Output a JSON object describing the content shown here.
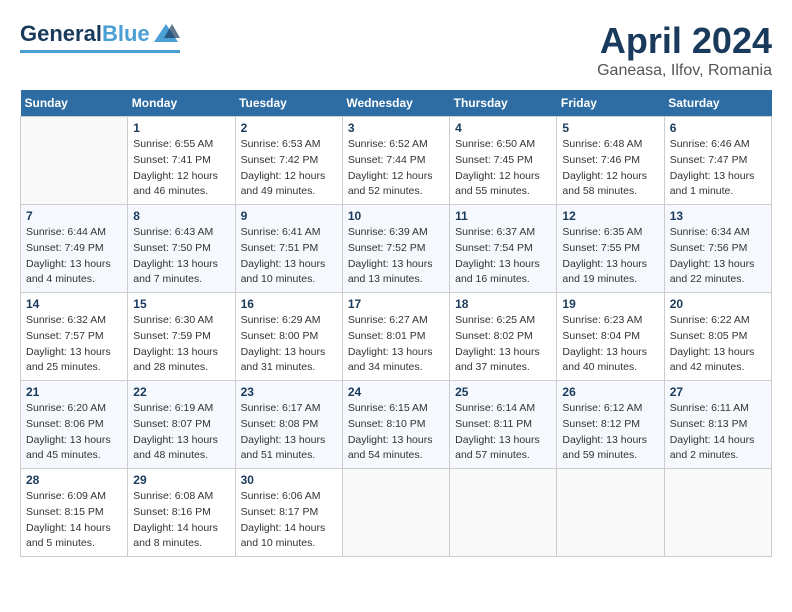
{
  "header": {
    "logo_general": "General",
    "logo_blue": "Blue",
    "title": "April 2024",
    "location": "Ganeasa, Ilfov, Romania"
  },
  "calendar": {
    "days_of_week": [
      "Sunday",
      "Monday",
      "Tuesday",
      "Wednesday",
      "Thursday",
      "Friday",
      "Saturday"
    ],
    "weeks": [
      [
        {
          "day": "",
          "info": ""
        },
        {
          "day": "1",
          "info": "Sunrise: 6:55 AM\nSunset: 7:41 PM\nDaylight: 12 hours\nand 46 minutes."
        },
        {
          "day": "2",
          "info": "Sunrise: 6:53 AM\nSunset: 7:42 PM\nDaylight: 12 hours\nand 49 minutes."
        },
        {
          "day": "3",
          "info": "Sunrise: 6:52 AM\nSunset: 7:44 PM\nDaylight: 12 hours\nand 52 minutes."
        },
        {
          "day": "4",
          "info": "Sunrise: 6:50 AM\nSunset: 7:45 PM\nDaylight: 12 hours\nand 55 minutes."
        },
        {
          "day": "5",
          "info": "Sunrise: 6:48 AM\nSunset: 7:46 PM\nDaylight: 12 hours\nand 58 minutes."
        },
        {
          "day": "6",
          "info": "Sunrise: 6:46 AM\nSunset: 7:47 PM\nDaylight: 13 hours\nand 1 minute."
        }
      ],
      [
        {
          "day": "7",
          "info": "Sunrise: 6:44 AM\nSunset: 7:49 PM\nDaylight: 13 hours\nand 4 minutes."
        },
        {
          "day": "8",
          "info": "Sunrise: 6:43 AM\nSunset: 7:50 PM\nDaylight: 13 hours\nand 7 minutes."
        },
        {
          "day": "9",
          "info": "Sunrise: 6:41 AM\nSunset: 7:51 PM\nDaylight: 13 hours\nand 10 minutes."
        },
        {
          "day": "10",
          "info": "Sunrise: 6:39 AM\nSunset: 7:52 PM\nDaylight: 13 hours\nand 13 minutes."
        },
        {
          "day": "11",
          "info": "Sunrise: 6:37 AM\nSunset: 7:54 PM\nDaylight: 13 hours\nand 16 minutes."
        },
        {
          "day": "12",
          "info": "Sunrise: 6:35 AM\nSunset: 7:55 PM\nDaylight: 13 hours\nand 19 minutes."
        },
        {
          "day": "13",
          "info": "Sunrise: 6:34 AM\nSunset: 7:56 PM\nDaylight: 13 hours\nand 22 minutes."
        }
      ],
      [
        {
          "day": "14",
          "info": "Sunrise: 6:32 AM\nSunset: 7:57 PM\nDaylight: 13 hours\nand 25 minutes."
        },
        {
          "day": "15",
          "info": "Sunrise: 6:30 AM\nSunset: 7:59 PM\nDaylight: 13 hours\nand 28 minutes."
        },
        {
          "day": "16",
          "info": "Sunrise: 6:29 AM\nSunset: 8:00 PM\nDaylight: 13 hours\nand 31 minutes."
        },
        {
          "day": "17",
          "info": "Sunrise: 6:27 AM\nSunset: 8:01 PM\nDaylight: 13 hours\nand 34 minutes."
        },
        {
          "day": "18",
          "info": "Sunrise: 6:25 AM\nSunset: 8:02 PM\nDaylight: 13 hours\nand 37 minutes."
        },
        {
          "day": "19",
          "info": "Sunrise: 6:23 AM\nSunset: 8:04 PM\nDaylight: 13 hours\nand 40 minutes."
        },
        {
          "day": "20",
          "info": "Sunrise: 6:22 AM\nSunset: 8:05 PM\nDaylight: 13 hours\nand 42 minutes."
        }
      ],
      [
        {
          "day": "21",
          "info": "Sunrise: 6:20 AM\nSunset: 8:06 PM\nDaylight: 13 hours\nand 45 minutes."
        },
        {
          "day": "22",
          "info": "Sunrise: 6:19 AM\nSunset: 8:07 PM\nDaylight: 13 hours\nand 48 minutes."
        },
        {
          "day": "23",
          "info": "Sunrise: 6:17 AM\nSunset: 8:08 PM\nDaylight: 13 hours\nand 51 minutes."
        },
        {
          "day": "24",
          "info": "Sunrise: 6:15 AM\nSunset: 8:10 PM\nDaylight: 13 hours\nand 54 minutes."
        },
        {
          "day": "25",
          "info": "Sunrise: 6:14 AM\nSunset: 8:11 PM\nDaylight: 13 hours\nand 57 minutes."
        },
        {
          "day": "26",
          "info": "Sunrise: 6:12 AM\nSunset: 8:12 PM\nDaylight: 13 hours\nand 59 minutes."
        },
        {
          "day": "27",
          "info": "Sunrise: 6:11 AM\nSunset: 8:13 PM\nDaylight: 14 hours\nand 2 minutes."
        }
      ],
      [
        {
          "day": "28",
          "info": "Sunrise: 6:09 AM\nSunset: 8:15 PM\nDaylight: 14 hours\nand 5 minutes."
        },
        {
          "day": "29",
          "info": "Sunrise: 6:08 AM\nSunset: 8:16 PM\nDaylight: 14 hours\nand 8 minutes."
        },
        {
          "day": "30",
          "info": "Sunrise: 6:06 AM\nSunset: 8:17 PM\nDaylight: 14 hours\nand 10 minutes."
        },
        {
          "day": "",
          "info": ""
        },
        {
          "day": "",
          "info": ""
        },
        {
          "day": "",
          "info": ""
        },
        {
          "day": "",
          "info": ""
        }
      ]
    ]
  }
}
